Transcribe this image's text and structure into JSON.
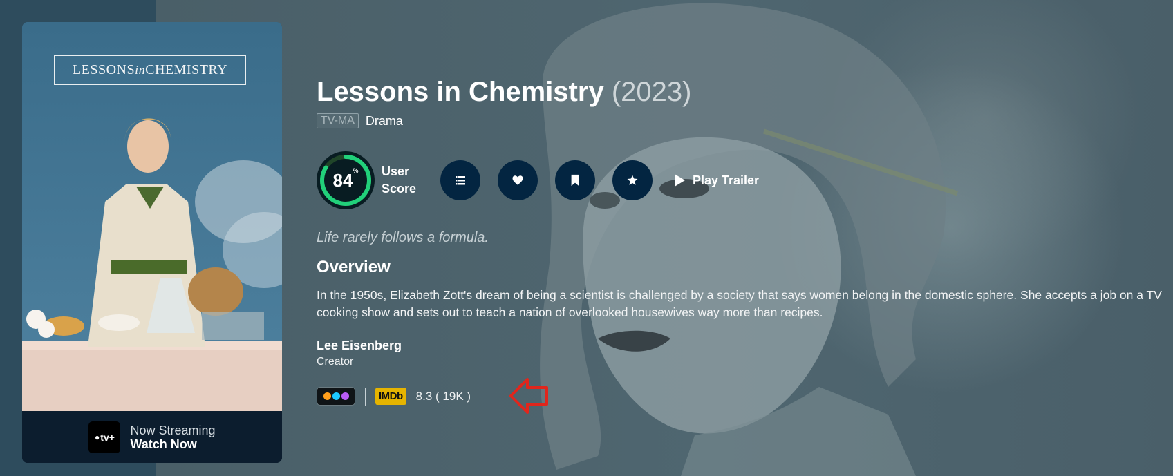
{
  "poster": {
    "title_part1": "LESSONS ",
    "title_part2": "in",
    "title_part3": " CHEMISTRY",
    "provider_logo": "tv+",
    "streaming_line1": "Now Streaming",
    "streaming_line2": "Watch Now"
  },
  "show": {
    "title": "Lessons in Chemistry",
    "year": "(2023)",
    "certification": "TV-MA",
    "genre": "Drama",
    "tagline": "Life rarely follows a formula.",
    "overview_heading": "Overview",
    "overview": "In the 1950s, Elizabeth Zott's dream of being a scientist is challenged by a society that says women belong in the domestic sphere. She accepts a job on a TV cooking show and sets out to teach a nation of overlooked housewives way more than recipes."
  },
  "score": {
    "value": "84",
    "unit": "%",
    "fraction": 0.84,
    "label_line1": "User",
    "label_line2": "Score",
    "ring_color": "#21d07a",
    "track_color": "#204529"
  },
  "actions": {
    "list_icon": "list-icon",
    "favorite_icon": "heart-icon",
    "watchlist_icon": "bookmark-icon",
    "rate_icon": "star-icon",
    "play_trailer_label": "Play Trailer"
  },
  "creator": {
    "name": "Lee Eisenberg",
    "role": "Creator"
  },
  "ratings": {
    "imdb_label": "IMDb",
    "imdb_score": "8.3 ( 19K )",
    "justwatch_colors": [
      "#ff9f1c",
      "#1cc8ff",
      "#b95cf5"
    ],
    "imdb_color": "#e6b400"
  },
  "annotation": {
    "arrow_color": "#e1261c"
  }
}
